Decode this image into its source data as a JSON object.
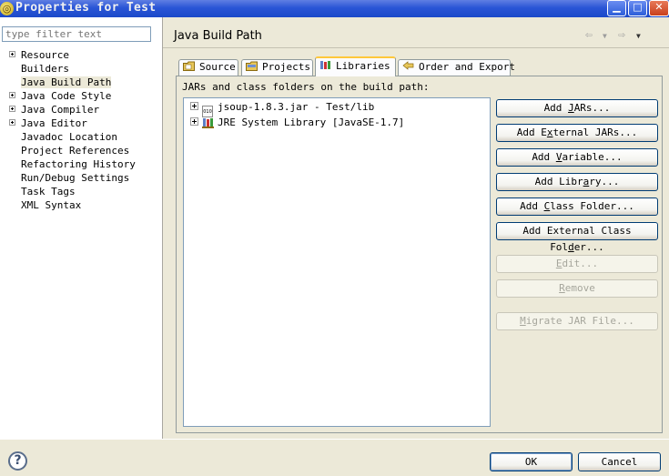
{
  "window": {
    "title": "Properties for Test",
    "icon": "eclipse-icon"
  },
  "filter": {
    "placeholder": "type filter text",
    "value": ""
  },
  "tree": [
    {
      "label": "Resource",
      "expandable": true
    },
    {
      "label": "Builders",
      "expandable": false
    },
    {
      "label": "Java Build Path",
      "expandable": false,
      "selected": true
    },
    {
      "label": "Java Code Style",
      "expandable": true
    },
    {
      "label": "Java Compiler",
      "expandable": true
    },
    {
      "label": "Java Editor",
      "expandable": true
    },
    {
      "label": "Javadoc Location",
      "expandable": false
    },
    {
      "label": "Project References",
      "expandable": false
    },
    {
      "label": "Refactoring History",
      "expandable": false
    },
    {
      "label": "Run/Debug Settings",
      "expandable": false
    },
    {
      "label": "Task Tags",
      "expandable": false
    },
    {
      "label": "XML Syntax",
      "expandable": false
    }
  ],
  "page": {
    "title": "Java Build Path"
  },
  "tabs": [
    {
      "label": "Source",
      "icon": "source-folder-icon",
      "active": false
    },
    {
      "label": "Projects",
      "icon": "projects-icon",
      "active": false
    },
    {
      "label": "Libraries",
      "icon": "libraries-icon",
      "active": true
    },
    {
      "label": "Order and Export",
      "icon": "order-export-icon",
      "active": false
    }
  ],
  "libraries": {
    "description": "JARs and class folders on the build path:",
    "entries": [
      {
        "label": "jsoup-1.8.3.jar - Test/lib",
        "icon": "jar-icon"
      },
      {
        "label": "JRE System Library [JavaSE-1.7]",
        "icon": "library-icon"
      }
    ]
  },
  "buttons": {
    "add_jars": {
      "pre": "Add ",
      "mn": "J",
      "post": "ARs..."
    },
    "add_external_jars": {
      "pre": "Add E",
      "mn": "x",
      "post": "ternal JARs..."
    },
    "add_variable": {
      "pre": "Add ",
      "mn": "V",
      "post": "ariable..."
    },
    "add_library": {
      "pre": "Add Libr",
      "mn": "a",
      "post": "ry..."
    },
    "add_class_folder": {
      "pre": "Add ",
      "mn": "C",
      "post": "lass Folder..."
    },
    "add_external_class_folder": {
      "pre": "Add External Class Fol",
      "mn": "d",
      "post": "er..."
    },
    "edit": {
      "pre": "",
      "mn": "E",
      "post": "dit..."
    },
    "remove": {
      "pre": "",
      "mn": "R",
      "post": "emove"
    },
    "migrate_jar": {
      "pre": "",
      "mn": "M",
      "post": "igrate JAR File..."
    }
  },
  "footer": {
    "ok": "OK",
    "cancel": "Cancel"
  }
}
